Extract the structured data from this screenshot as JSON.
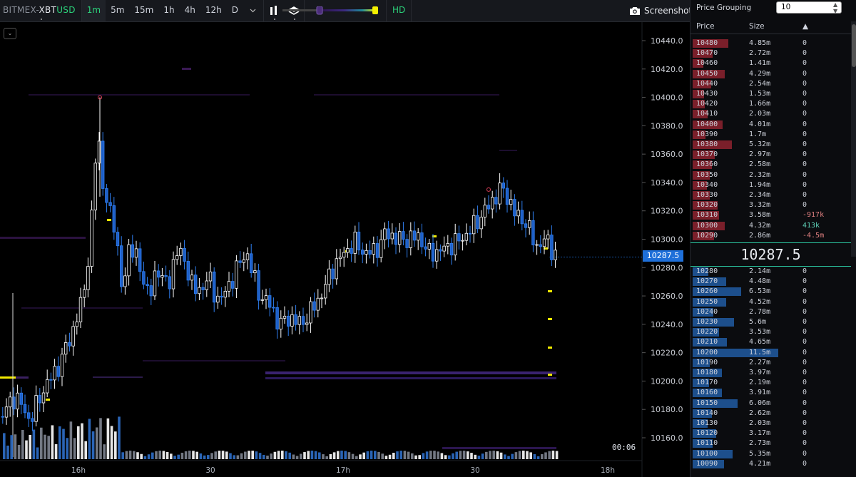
{
  "toolbar": {
    "exchange": "BITMEX-",
    "symbol_base": "XBT",
    "symbol_quote": "USD",
    "timeframes": [
      "1m",
      "5m",
      "15m",
      "1h",
      "4h",
      "12h",
      "D"
    ],
    "active_timeframe": "1m",
    "hd_label": "HD",
    "screenshot_label": "Screenshot",
    "colors": {
      "accent": "#2bd27a",
      "badge": "#1e6fd9"
    }
  },
  "chart": {
    "current_price": "10287.5",
    "clock": "00:06",
    "y_ticks": [
      "10440.0",
      "10420.0",
      "10400.0",
      "10380.0",
      "10360.0",
      "10340.0",
      "10320.0",
      "10300.0",
      "10280.0",
      "10260.0",
      "10240.0",
      "10220.0",
      "10200.0",
      "10180.0",
      "10160.0"
    ],
    "x_ticks": [
      "16h",
      "30",
      "17h",
      "30",
      "18h"
    ]
  },
  "book": {
    "grouping_label": "Price Grouping",
    "grouping_value": "10",
    "headers": {
      "price": "Price",
      "size": "Size",
      "sort": "▲"
    },
    "mid_price": "10287.5",
    "asks": [
      {
        "p": "10480",
        "s": "4.85m",
        "a": "0",
        "w": 4.85
      },
      {
        "p": "10470",
        "s": "2.72m",
        "a": "0",
        "w": 2.72
      },
      {
        "p": "10460",
        "s": "1.41m",
        "a": "0",
        "w": 1.41
      },
      {
        "p": "10450",
        "s": "4.29m",
        "a": "0",
        "w": 4.29
      },
      {
        "p": "10440",
        "s": "2.54m",
        "a": "0",
        "w": 2.54
      },
      {
        "p": "10430",
        "s": "1.53m",
        "a": "0",
        "w": 1.53
      },
      {
        "p": "10420",
        "s": "1.66m",
        "a": "0",
        "w": 1.66
      },
      {
        "p": "10410",
        "s": "2.03m",
        "a": "0",
        "w": 2.03
      },
      {
        "p": "10400",
        "s": "4.01m",
        "a": "0",
        "w": 4.01
      },
      {
        "p": "10390",
        "s": "1.7m",
        "a": "0",
        "w": 1.7
      },
      {
        "p": "10380",
        "s": "5.32m",
        "a": "0",
        "w": 5.32
      },
      {
        "p": "10370",
        "s": "2.97m",
        "a": "0",
        "w": 2.97
      },
      {
        "p": "10360",
        "s": "2.58m",
        "a": "0",
        "w": 2.58
      },
      {
        "p": "10350",
        "s": "2.32m",
        "a": "0",
        "w": 2.32
      },
      {
        "p": "10340",
        "s": "1.94m",
        "a": "0",
        "w": 1.94
      },
      {
        "p": "10330",
        "s": "2.34m",
        "a": "0",
        "w": 2.34
      },
      {
        "p": "10320",
        "s": "3.32m",
        "a": "0",
        "w": 3.32
      },
      {
        "p": "10310",
        "s": "3.58m",
        "a": "-917k",
        "w": 3.58
      },
      {
        "p": "10300",
        "s": "4.32m",
        "a": "413k",
        "w": 4.32
      },
      {
        "p": "10290",
        "s": "2.86m",
        "a": "-4.5m",
        "w": 2.86
      }
    ],
    "bids": [
      {
        "p": "10280",
        "s": "2.14m",
        "a": "0",
        "w": 2.14
      },
      {
        "p": "10270",
        "s": "4.48m",
        "a": "0",
        "w": 4.48
      },
      {
        "p": "10260",
        "s": "6.53m",
        "a": "0",
        "w": 6.53
      },
      {
        "p": "10250",
        "s": "4.52m",
        "a": "0",
        "w": 4.52
      },
      {
        "p": "10240",
        "s": "2.78m",
        "a": "0",
        "w": 2.78
      },
      {
        "p": "10230",
        "s": "5.6m",
        "a": "0",
        "w": 5.6
      },
      {
        "p": "10220",
        "s": "3.53m",
        "a": "0",
        "w": 3.53
      },
      {
        "p": "10210",
        "s": "4.65m",
        "a": "0",
        "w": 4.65
      },
      {
        "p": "10200",
        "s": "11.5m",
        "a": "0",
        "w": 11.5
      },
      {
        "p": "10190",
        "s": "2.27m",
        "a": "0",
        "w": 2.27
      },
      {
        "p": "10180",
        "s": "3.97m",
        "a": "0",
        "w": 3.97
      },
      {
        "p": "10170",
        "s": "2.19m",
        "a": "0",
        "w": 2.19
      },
      {
        "p": "10160",
        "s": "3.91m",
        "a": "0",
        "w": 3.91
      },
      {
        "p": "10150",
        "s": "6.06m",
        "a": "0",
        "w": 6.06
      },
      {
        "p": "10140",
        "s": "2.62m",
        "a": "0",
        "w": 2.62
      },
      {
        "p": "10130",
        "s": "2.03m",
        "a": "0",
        "w": 2.03
      },
      {
        "p": "10120",
        "s": "3.17m",
        "a": "0",
        "w": 3.17
      },
      {
        "p": "10110",
        "s": "2.73m",
        "a": "0",
        "w": 2.73
      },
      {
        "p": "10100",
        "s": "5.35m",
        "a": "0",
        "w": 5.35
      },
      {
        "p": "10090",
        "s": "4.21m",
        "a": "0",
        "w": 4.21
      }
    ]
  }
}
